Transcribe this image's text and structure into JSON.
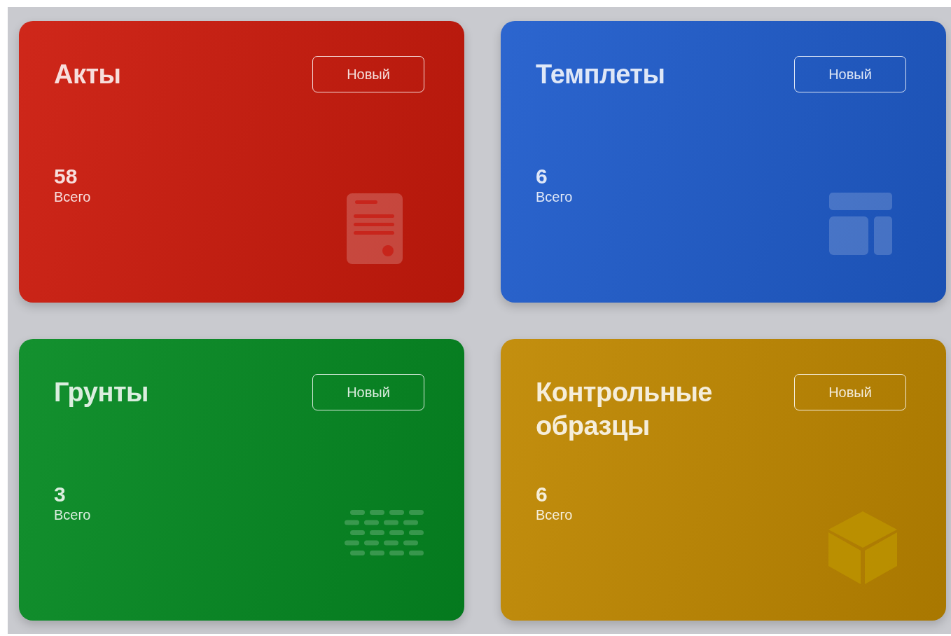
{
  "cards": [
    {
      "title": "Акты",
      "button": "Новый",
      "count": "58",
      "count_label": "Всего",
      "kind": "document",
      "color": "#cc1a0c"
    },
    {
      "title": "Темплеты",
      "button": "Новый",
      "count": "6",
      "count_label": "Всего",
      "kind": "layout",
      "color": "#1f5ccc"
    },
    {
      "title": "Грунты",
      "button": "Новый",
      "count": "3",
      "count_label": "Всего",
      "kind": "grid",
      "color": "#058a22"
    },
    {
      "title": "Контрольные образцы",
      "button": "Новый",
      "count": "6",
      "count_label": "Всего",
      "kind": "cube",
      "color": "#c08800"
    }
  ]
}
